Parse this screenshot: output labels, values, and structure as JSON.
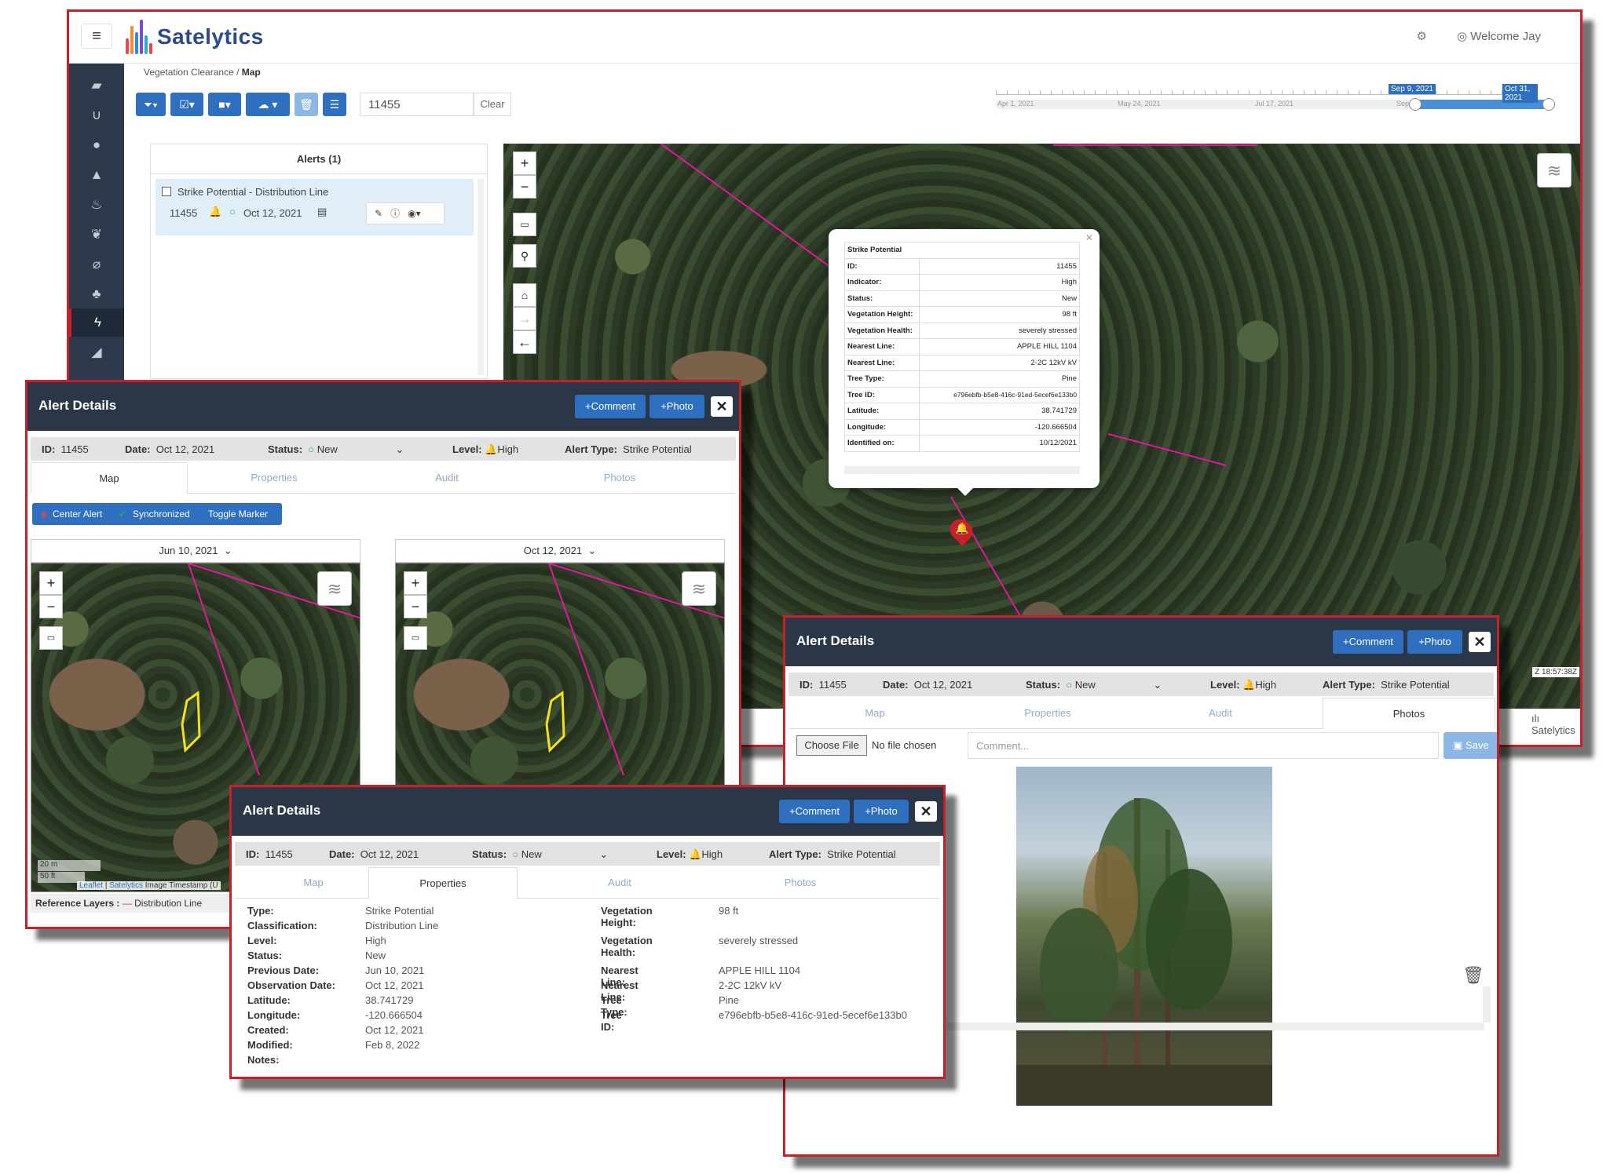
{
  "app": {
    "brand": "Satelytics",
    "welcome": "Welcome Jay"
  },
  "breadcrumb": {
    "parent": "Vegetation Clearance",
    "current": "Map"
  },
  "search": {
    "value": "11455",
    "clear": "Clear"
  },
  "timeline": {
    "ticks": [
      "Apr 1, 2021",
      "May 24, 2021",
      "Jul 17, 2021",
      "Sep"
    ],
    "start_label": "Sep 9, 2021",
    "end_label": "Oct 31, 2021"
  },
  "alerts_panel": {
    "header": "Alerts (1)",
    "item": {
      "title": "Strike Potential - Distribution Line",
      "id": "11455",
      "date": "Oct 12, 2021"
    }
  },
  "popup": {
    "title": "Strike Potential",
    "rows": [
      {
        "k": "ID:",
        "v": "11455"
      },
      {
        "k": "Indicator:",
        "v": "High"
      },
      {
        "k": "Status:",
        "v": "New"
      },
      {
        "k": "Vegetation Height:",
        "v": "98 ft"
      },
      {
        "k": "Vegetation Health:",
        "v": "severely stressed"
      },
      {
        "k": "Nearest Line:",
        "v": "APPLE HILL 1104"
      },
      {
        "k": "Nearest Line:",
        "v": "2-2C 12kV kV"
      },
      {
        "k": "Tree Type:",
        "v": "Pine"
      },
      {
        "k": "Tree ID:",
        "v": "e796ebfb-b5e8-416c-91ed-5ecef6e133b0"
      },
      {
        "k": "Latitude:",
        "v": "38.741729"
      },
      {
        "k": "Longitude:",
        "v": "-120.666504"
      },
      {
        "k": "Identified on:",
        "v": "10/12/2021"
      }
    ]
  },
  "map_footer": {
    "timestamp": "Z 18:57:38Z",
    "attribution": "Satelytics"
  },
  "dialog": {
    "title": "Alert Details",
    "comment_btn": "+Comment",
    "photo_btn": "+Photo",
    "close": "✕",
    "id_label": "ID:",
    "id": "11455",
    "date_label": "Date:",
    "date": "Oct 12, 2021",
    "status_label": "Status:",
    "status": "New",
    "level_label": "Level:",
    "level": "High",
    "type_label": "Alert Type:",
    "type": "Strike Potential",
    "tabs": [
      "Map",
      "Properties",
      "Audit",
      "Photos"
    ]
  },
  "map_tab": {
    "center_alert": "Center Alert",
    "synchronized": "Synchronized",
    "toggle_marker": "Toggle Marker",
    "date_left": "Jun 10, 2021",
    "date_right": "Oct 12, 2021",
    "scale_m": "20 m",
    "scale_ft": "50 ft",
    "attribution_leaflet": "Leaflet",
    "attribution_sep": "|",
    "attribution_sat": "Satelytics",
    "attribution_rest": "Image Timestamp (U",
    "ref_layers": "Reference Layers :",
    "ref_dist": "Distribution Line"
  },
  "photos_tab": {
    "choose_file": "Choose File",
    "no_file": "No file chosen",
    "comment_placeholder": "Comment...",
    "save": "Save"
  },
  "properties": {
    "left": [
      {
        "k": "Type:",
        "v": "Strike Potential"
      },
      {
        "k": "Classification:",
        "v": "Distribution Line"
      },
      {
        "k": "Level:",
        "v": "High"
      },
      {
        "k": "Status:",
        "v": "New"
      },
      {
        "k": "Previous Date:",
        "v": "Jun 10, 2021"
      },
      {
        "k": "Observation Date:",
        "v": "Oct 12, 2021"
      },
      {
        "k": "Latitude:",
        "v": "38.741729"
      },
      {
        "k": "Longitude:",
        "v": "-120.666504"
      },
      {
        "k": "Created:",
        "v": "Oct 12, 2021"
      },
      {
        "k": "Modified:",
        "v": "Feb 8, 2022"
      },
      {
        "k": "Notes:",
        "v": ""
      }
    ],
    "right": [
      {
        "k": "Vegetation Height:",
        "v": "98 ft"
      },
      {
        "k": "Vegetation Health:",
        "v": "severely stressed"
      },
      {
        "k": "Nearest Line:",
        "v": "APPLE HILL 1104"
      },
      {
        "k": "Nearest Line:",
        "v": "2-2C 12kV kV"
      },
      {
        "k": "Tree Type:",
        "v": "Pine"
      },
      {
        "k": "Tree ID:",
        "v": "e796ebfb-b5e8-416c-91ed-5ecef6e133b0"
      }
    ]
  },
  "colors": {
    "accent": "#2f6fbf",
    "border_red": "#c8202a",
    "header_dark": "#2b3647",
    "line_magenta": "#e0189a",
    "alert_red": "#d0282e",
    "status_green": "#3aa84a"
  }
}
